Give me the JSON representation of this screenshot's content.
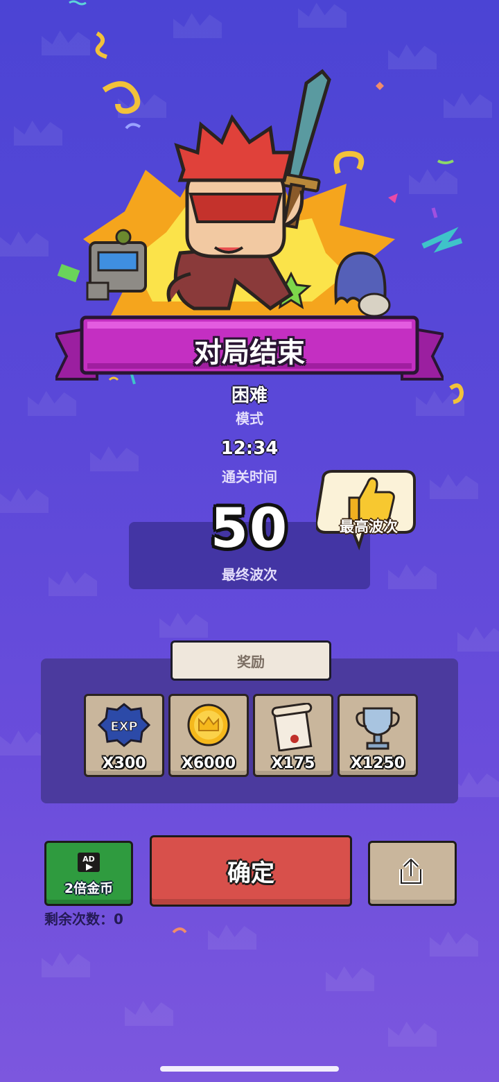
{
  "header": {
    "title": "对局结束"
  },
  "stats": {
    "mode_value": "困难",
    "mode_label": "模式",
    "time_value": "12:34",
    "time_label": "通关时间",
    "wave_value": "50",
    "wave_label": "最终波次"
  },
  "badge": {
    "label": "最高波次",
    "icon": "thumbs-up-icon"
  },
  "rewards": {
    "title": "奖励",
    "items": [
      {
        "icon": "exp-icon",
        "icon_text": "EXP",
        "qty": "X300"
      },
      {
        "icon": "gold-coin-icon",
        "qty": "X6000"
      },
      {
        "icon": "scroll-icon",
        "qty": "X175"
      },
      {
        "icon": "trophy-icon",
        "qty": "X1250"
      }
    ]
  },
  "actions": {
    "ad_tag": "AD",
    "ad_button_label": "2倍金币",
    "remaining_text": "剩余次数：0",
    "confirm_label": "确定",
    "share_icon": "share-icon"
  },
  "colors": {
    "background": "#5b48d8",
    "ribbon": "#c42fc2",
    "confirm": "#d8504b",
    "ad": "#2f9b3f",
    "reward_card": "#c9b69c"
  }
}
